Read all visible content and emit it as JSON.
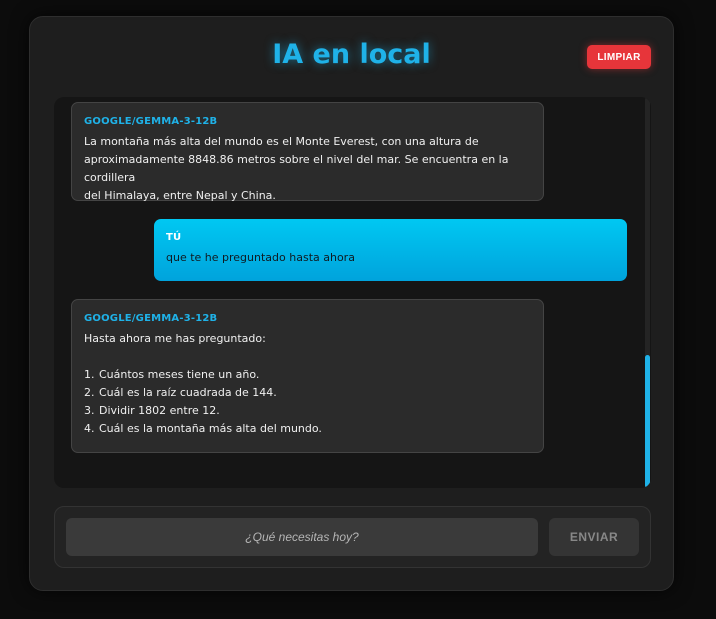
{
  "header": {
    "title": "IA en local",
    "clear_label": "LIMPIAR"
  },
  "colors": {
    "accent": "#1fb2e8",
    "clear_button": "#e7353a",
    "user_bubble": "#00b6e8",
    "background": "#1e1e1e"
  },
  "messages": [
    {
      "role": "assistant",
      "sender": "GOOGLE/GEMMA-3-12B",
      "text": "La montaña más alta del mundo es el Monte Everest, con una altura de\naproximadamente 8848.86 metros sobre el nivel del mar. Se encuentra en la cordillera\ndel Himalaya, entre Nepal y China."
    },
    {
      "role": "user",
      "sender": "TÚ",
      "text": "que te he preguntado hasta ahora"
    },
    {
      "role": "assistant",
      "sender": "GOOGLE/GEMMA-3-12B",
      "text": "Hasta ahora me has preguntado:",
      "items": [
        {
          "num": "1.",
          "text": "Cuántos meses tiene un año."
        },
        {
          "num": "2.",
          "text": "Cuál es la raíz cuadrada de 144."
        },
        {
          "num": "3.",
          "text": "Dividir 1802 entre 12."
        },
        {
          "num": "4.",
          "text": "Cuál es la montaña más alta del mundo."
        }
      ]
    }
  ],
  "input": {
    "placeholder": "¿Qué necesitas hoy?",
    "value": ""
  },
  "send_label": "ENVIAR"
}
